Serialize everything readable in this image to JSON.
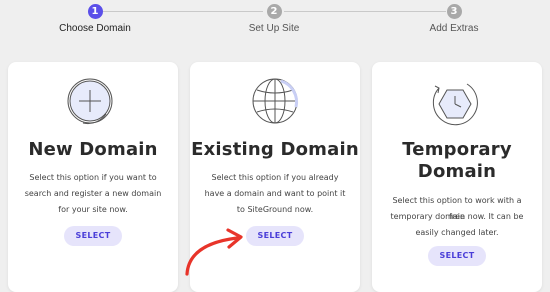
{
  "stepper": {
    "steps": [
      {
        "number": "1",
        "label": "Choose Domain",
        "active": true
      },
      {
        "number": "2",
        "label": "Set Up Site",
        "active": false
      },
      {
        "number": "3",
        "label": "Add Extras",
        "active": false
      }
    ]
  },
  "cards": [
    {
      "icon": "plus-circle-icon",
      "title": "New Domain",
      "description": [
        "Select this option if you want to",
        "search and register a new domain",
        "for your site now."
      ],
      "button": "SELECT"
    },
    {
      "icon": "globe-icon",
      "title": "Existing Domain",
      "description": [
        "Select this option if you already",
        "have a domain and want to point it",
        "to SiteGround now."
      ],
      "button": "SELECT"
    },
    {
      "icon": "clock-rotate-icon",
      "title_lines": [
        "Temporary",
        "Domain"
      ],
      "description": [
        "Select this option to work with a free",
        "temporary domain now. It can be",
        "easily changed later."
      ],
      "button": "SELECT"
    }
  ],
  "colors": {
    "accent": "#5b4fe9",
    "button_bg": "#e6e4fb",
    "arrow": "#e8342a"
  }
}
